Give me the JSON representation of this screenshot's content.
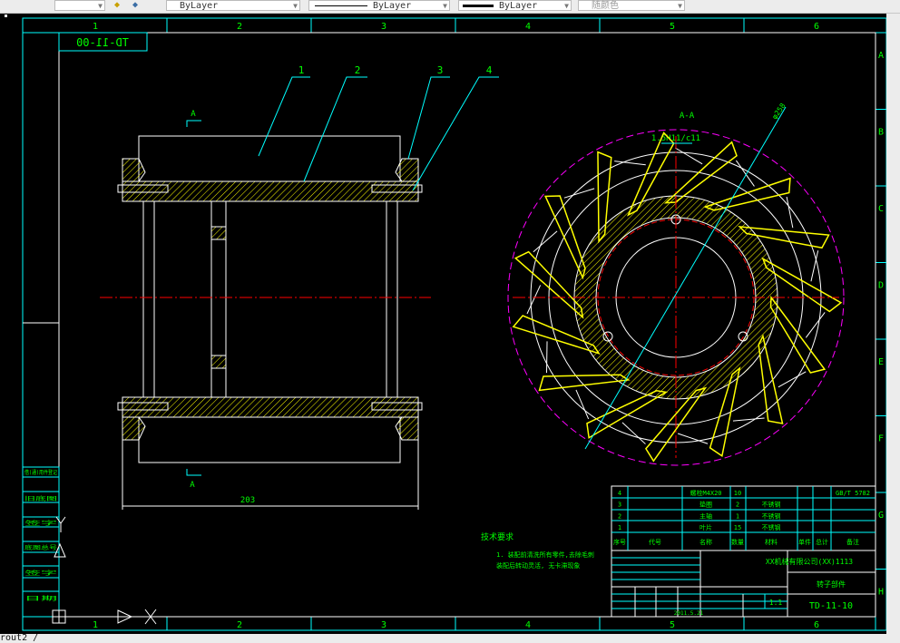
{
  "toolbar": {
    "layer_state_icons": [
      "layer-previous-icon",
      "layer-states-icon"
    ],
    "color_control": "ByLayer",
    "linetype_control": "ByLayer",
    "lineweight_control": "ByLayer",
    "plotstyle_control": "随颜色"
  },
  "drawing": {
    "zone_columns": [
      "1",
      "2",
      "3",
      "4",
      "5",
      "6"
    ],
    "zone_rows": [
      "A",
      "B",
      "C",
      "D",
      "E",
      "F",
      "G",
      "H"
    ],
    "drawing_number_mirrored": "TD-11-00",
    "balloons": [
      "1",
      "2",
      "3",
      "4"
    ],
    "section_mark": "A",
    "section_title": "A-A",
    "fit_note": "1.5H11/c11",
    "diameter_note": "φ258",
    "dimension": "203",
    "tech_req_title": "技术要求",
    "tech_req_lines": [
      "1. 装配前清洗所有零件,去除毛刺",
      "装配后转动灵活, 无卡滞现象"
    ],
    "colors": {
      "frame": "#00ffff",
      "text": "#00ff00",
      "outline": "#ffffff",
      "center": "#ff0000",
      "hatch": "#ffff00",
      "circle": "#ff00ff"
    }
  },
  "title_block": {
    "parts": [
      {
        "no": "4",
        "name": "",
        "spec": "螺栓M4X20",
        "qty": "10",
        "material": "",
        "std": "GB/T 5782"
      },
      {
        "no": "3",
        "name": "",
        "spec": "垫圈",
        "qty": "2",
        "material": "不锈钢",
        "std": ""
      },
      {
        "no": "2",
        "name": "",
        "spec": "主轴",
        "qty": "1",
        "material": "不锈钢",
        "std": ""
      },
      {
        "no": "1",
        "name": "",
        "spec": "叶片",
        "qty": "15",
        "material": "不锈钢",
        "std": ""
      }
    ],
    "header": [
      "序号",
      "代号",
      "名称",
      "数量",
      "材料",
      "单件",
      "总计",
      "备注"
    ],
    "company": "XX机械有限公司(XX)1113",
    "part_title": "转子部件",
    "drawing_number": "TD-11-10",
    "scale": "1:1",
    "date": "2011.5.21"
  },
  "left_table": [
    "借(通)用件登记",
    "旧底图",
    "签字",
    "底图总号",
    "签字",
    "日期"
  ],
  "command_line": "rout2 /"
}
